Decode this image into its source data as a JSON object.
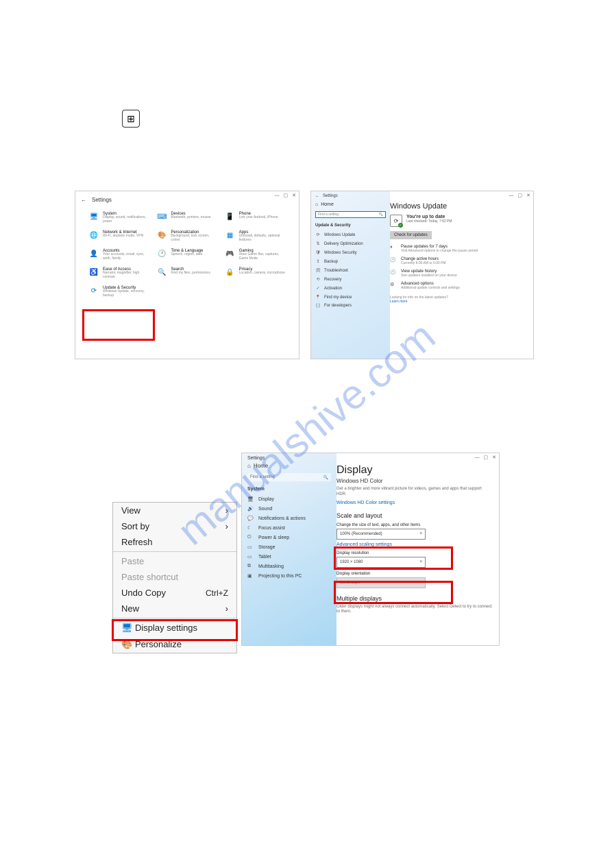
{
  "watermark": "manualshive.com",
  "winkey": {
    "glyph": "⊞"
  },
  "settings_main": {
    "title": "Settings",
    "tiles": [
      {
        "icon": "🖥",
        "title": "System",
        "sub": "Display, sound, notifications, power"
      },
      {
        "icon": "⌨",
        "title": "Devices",
        "sub": "Bluetooth, printers, mouse"
      },
      {
        "icon": "📱",
        "title": "Phone",
        "sub": "Link your Android, iPhone"
      },
      {
        "icon": "🌐",
        "title": "Network & Internet",
        "sub": "Wi-Fi, airplane mode, VPN"
      },
      {
        "icon": "🎨",
        "title": "Personalization",
        "sub": "Background, lock screen, colors"
      },
      {
        "icon": "▦",
        "title": "Apps",
        "sub": "Uninstall, defaults, optional features"
      },
      {
        "icon": "👤",
        "title": "Accounts",
        "sub": "Your accounts, email, sync, work, family"
      },
      {
        "icon": "🕐",
        "title": "Time & Language",
        "sub": "Speech, region, date"
      },
      {
        "icon": "🎮",
        "title": "Gaming",
        "sub": "Xbox Game Bar, captures, Game Mode"
      },
      {
        "icon": "♿",
        "title": "Ease of Access",
        "sub": "Narrator, magnifier, high contrast"
      },
      {
        "icon": "🔍",
        "title": "Search",
        "sub": "Find my files, permissions"
      },
      {
        "icon": "🔒",
        "title": "Privacy",
        "sub": "Location, camera, microphone"
      },
      {
        "icon": "⟳",
        "title": "Update & Security",
        "sub": "Windows Update, recovery, backup"
      }
    ]
  },
  "windows_update": {
    "sidebar": {
      "title": "Settings",
      "home": "Home",
      "search_placeholder": "Find a setting",
      "section": "Update & Security",
      "items": [
        {
          "icon": "⟳",
          "label": "Windows Update"
        },
        {
          "icon": "⇅",
          "label": "Delivery Optimization"
        },
        {
          "icon": "🛡",
          "label": "Windows Security"
        },
        {
          "icon": "↥",
          "label": "Backup"
        },
        {
          "icon": "🛠",
          "label": "Troubleshoot"
        },
        {
          "icon": "⟲",
          "label": "Recovery"
        },
        {
          "icon": "✓",
          "label": "Activation"
        },
        {
          "icon": "📍",
          "label": "Find my device"
        },
        {
          "icon": "{ }",
          "label": "For developers"
        }
      ]
    },
    "main": {
      "heading": "Windows Update",
      "status_title": "You're up to date",
      "status_sub": "Last checked: Today, 7:52 PM",
      "check_btn": "Check for updates",
      "rows": [
        {
          "icon": "⏸",
          "title": "Pause updates for 7 days",
          "sub": "Visit Advanced options to change the pause period"
        },
        {
          "icon": "🕐",
          "title": "Change active hours",
          "sub": "Currently 8:00 AM to 5:00 PM"
        },
        {
          "icon": "🕘",
          "title": "View update history",
          "sub": "See updates installed on your device"
        },
        {
          "icon": "⚙",
          "title": "Advanced options",
          "sub": "Additional update controls and settings"
        }
      ],
      "info_text": "Looking for info on the latest updates?",
      "info_link": "Learn more"
    }
  },
  "context_menu": {
    "items": [
      {
        "label": "View",
        "arrow": true
      },
      {
        "label": "Sort by",
        "arrow": true
      },
      {
        "label": "Refresh"
      },
      {
        "sep": true
      },
      {
        "label": "Paste",
        "disabled": true
      },
      {
        "label": "Paste shortcut",
        "disabled": true
      },
      {
        "label": "Undo Copy",
        "shortcut": "Ctrl+Z"
      },
      {
        "label": "New",
        "arrow": true
      },
      {
        "sep": true
      },
      {
        "label": "Display settings",
        "icon": "🖥",
        "icon_colored": true,
        "highlight": true
      },
      {
        "label": "Personalize",
        "icon": "🎨",
        "icon_colored": true
      }
    ]
  },
  "display_settings": {
    "sidebar": {
      "title": "Settings",
      "home": "Home",
      "search_placeholder": "Find a setting",
      "section": "System",
      "items": [
        {
          "icon": "🖥",
          "label": "Display"
        },
        {
          "icon": "🔊",
          "label": "Sound"
        },
        {
          "icon": "💬",
          "label": "Notifications & actions"
        },
        {
          "icon": "☾",
          "label": "Focus assist"
        },
        {
          "icon": "⏻",
          "label": "Power & sleep"
        },
        {
          "icon": "▭",
          "label": "Storage"
        },
        {
          "icon": "▭",
          "label": "Tablet"
        },
        {
          "icon": "⧉",
          "label": "Multitasking"
        },
        {
          "icon": "▣",
          "label": "Projecting to this PC"
        }
      ]
    },
    "main": {
      "heading": "Display",
      "subheading": "Windows HD Color",
      "desc": "Get a brighter and more vibrant picture for videos, games and apps that support HDR.",
      "hdcolor_link": "Windows HD Color settings",
      "scale_heading": "Scale and layout",
      "scale_label": "Change the size of text, apps, and other items",
      "scale_value": "100% (Recommended)",
      "adv_scale_link": "Advanced scaling settings",
      "res_label": "Display resolution",
      "res_value": "1920 × 1080",
      "orient_label": "Display orientation",
      "orient_value": "Landscape",
      "multi_heading": "Multiple displays",
      "multi_desc": "Older displays might not always connect automatically. Select Detect to try to connect to them."
    }
  }
}
